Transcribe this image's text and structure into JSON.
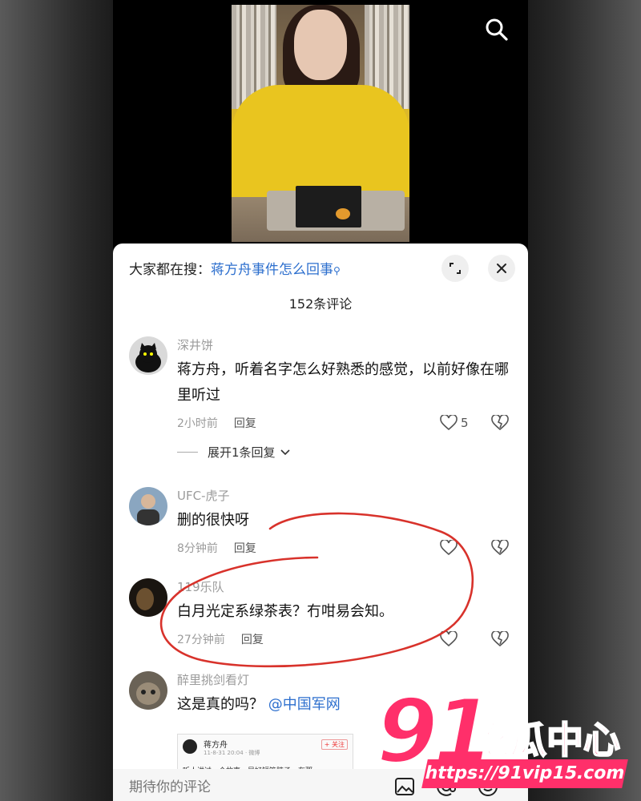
{
  "top_bar": {
    "search_icon": "search-icon"
  },
  "sheet": {
    "hot_search_prefix": "大家都在搜：",
    "hot_search_query": "蒋方舟事件怎么回事",
    "expand_icon": "expand-icon",
    "close_icon": "close-icon",
    "comment_count": "152条评论"
  },
  "comments": [
    {
      "username": "深井饼",
      "text": "蒋方舟，听着名字怎么好熟悉的感觉，以前好像在哪里听过",
      "time": "2小时前",
      "reply_label": "回复",
      "likes": "5",
      "expand_replies": "展开1条回复"
    },
    {
      "username": "UFC-虎子",
      "text": "删的很快呀",
      "time": "8分钟前",
      "reply_label": "回复",
      "likes": ""
    },
    {
      "username": "119乐队",
      "text": "白月光定系绿茶表？冇咁易会知。",
      "time": "27分钟前",
      "reply_label": "回复",
      "likes": ""
    },
    {
      "username": "醉里挑剑看灯",
      "text": "这是真的吗？",
      "mention": "@中国军网",
      "embed": {
        "name": "蒋方舟",
        "meta": "11-8-31 20:04 · 微博",
        "follow": "+ 关注",
        "body": "听人讲过一个故事，是好短篇脖子。在那"
      }
    }
  ],
  "input_bar": {
    "placeholder": "期待你的评论",
    "icons": [
      "image-icon",
      "at-icon",
      "emoji-icon"
    ]
  },
  "watermark": {
    "number": "91",
    "brand": "吃瓜中心",
    "url": "https://91vip15.com"
  },
  "colors": {
    "accent_blue": "#2d6fce",
    "annotation_red": "#d8322b",
    "watermark_pink": "#ff2f6a"
  }
}
